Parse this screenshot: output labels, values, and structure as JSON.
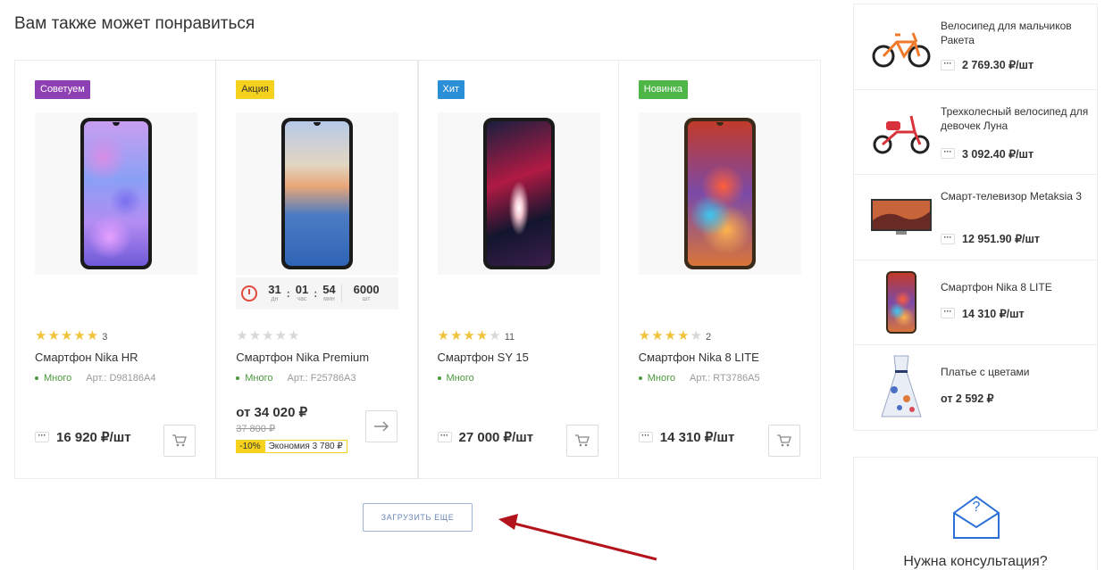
{
  "section_title": "Вам также может понравиться",
  "products": [
    {
      "badge": "Советуем",
      "rating_filled": "★★★★★",
      "rating_empty": "",
      "rating_count": "3",
      "name": "Смартфон Nika HR",
      "stock": "Много",
      "article": "Арт.: D98186A4",
      "price": "16 920 ₽/шт",
      "unit_label": "···"
    },
    {
      "badge": "Акция",
      "timer": {
        "days": "31",
        "days_label": "дн",
        "hours": "01",
        "hours_label": "час",
        "minutes": "54",
        "minutes_label": "мин",
        "qty": "6000",
        "qty_label": "шт"
      },
      "rating_filled": "",
      "rating_empty": "★★★★★",
      "rating_count": "",
      "name": "Смартфон Nika Premium",
      "stock": "Много",
      "article": "Арт.: F25786A3",
      "price": "от 34 020 ₽",
      "old_price": "37 800 ₽",
      "discount_pct": "-10%",
      "discount_save": "Экономия 3 780 ₽"
    },
    {
      "badge": "Хит",
      "rating_filled": "★★★★",
      "rating_empty": "★",
      "rating_count": "11",
      "name": "Смартфон SY 15",
      "stock": "Много",
      "article": "",
      "price": "27 000 ₽/шт",
      "unit_label": "···"
    },
    {
      "badge": "Новинка",
      "rating_filled": "★★★★",
      "rating_empty": "★",
      "rating_count": "2",
      "name": "Смартфон Nika 8 LITE",
      "stock": "Много",
      "article": "Арт.: RT3786A5",
      "price": "14 310 ₽/шт",
      "unit_label": "···"
    }
  ],
  "load_more_label": "ЗАГРУЗИТЬ ЕЩЕ",
  "sidebar": {
    "items": [
      {
        "title": "Велосипед для мальчиков Ракета",
        "price": "2 769.30 ₽/шт",
        "unit_label": "···"
      },
      {
        "title": "Трехколесный велосипед для девочек Луна",
        "price": "3 092.40 ₽/шт",
        "unit_label": "···"
      },
      {
        "title": "Смарт-телевизор Metaksia 3",
        "price": "12 951.90 ₽/шт",
        "unit_label": "···"
      },
      {
        "title": "Смартфон Nika 8 LITE",
        "price": "14 310 ₽/шт",
        "unit_label": "···"
      },
      {
        "title": "Платье с цветами",
        "price": "от 2 592 ₽",
        "unit_label": ""
      }
    ]
  },
  "consultation_title": "Нужна консультация?"
}
